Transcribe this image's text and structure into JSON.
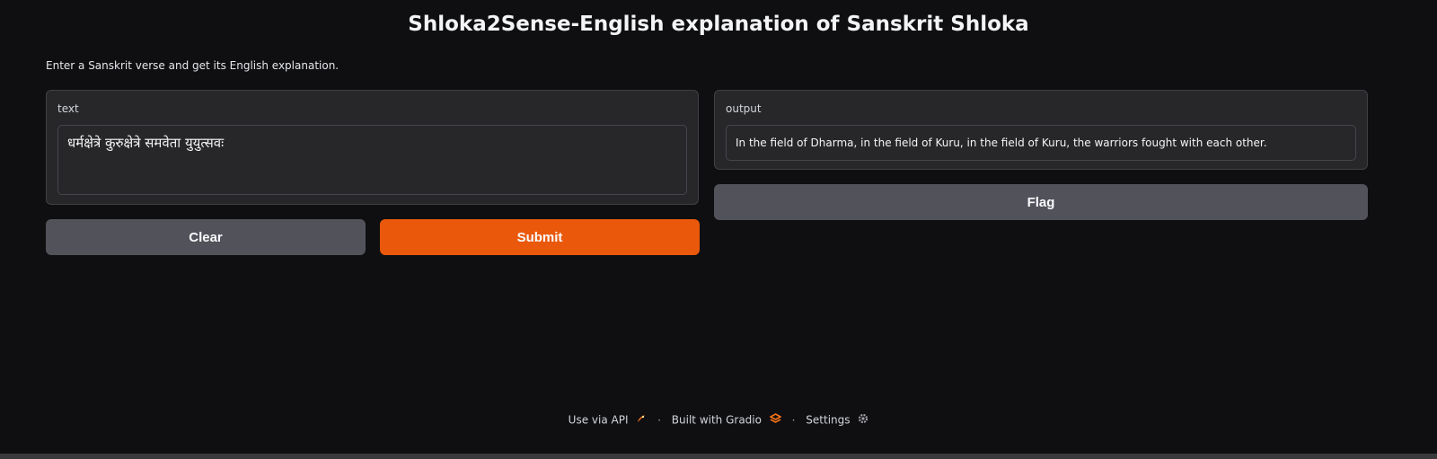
{
  "header": {
    "title": "Shloka2Sense-English explanation of Sanskrit Shloka",
    "description": "Enter a Sanskrit verse and get its English explanation."
  },
  "input_panel": {
    "label": "text",
    "value": "धर्मक्षेत्रे कुरुक्षेत्रे समवेता युयुत्सवः"
  },
  "output_panel": {
    "label": "output",
    "value": "In the field of Dharma, in the field of Kuru, in the field of Kuru, the warriors fought with each other."
  },
  "buttons": {
    "clear_label": "Clear",
    "submit_label": "Submit",
    "flag_label": "Flag"
  },
  "footer": {
    "api_label": "Use via API",
    "separator": "·",
    "gradio_label": "Built with Gradio",
    "settings_label": "Settings",
    "api_icon": "rocket-icon",
    "gradio_icon": "gradio-logo-icon",
    "settings_icon": "gear-icon"
  },
  "colors": {
    "accent": "#ea580c",
    "background": "#0f0f11",
    "panel": "#27272a",
    "secondary_button": "#52525b"
  }
}
